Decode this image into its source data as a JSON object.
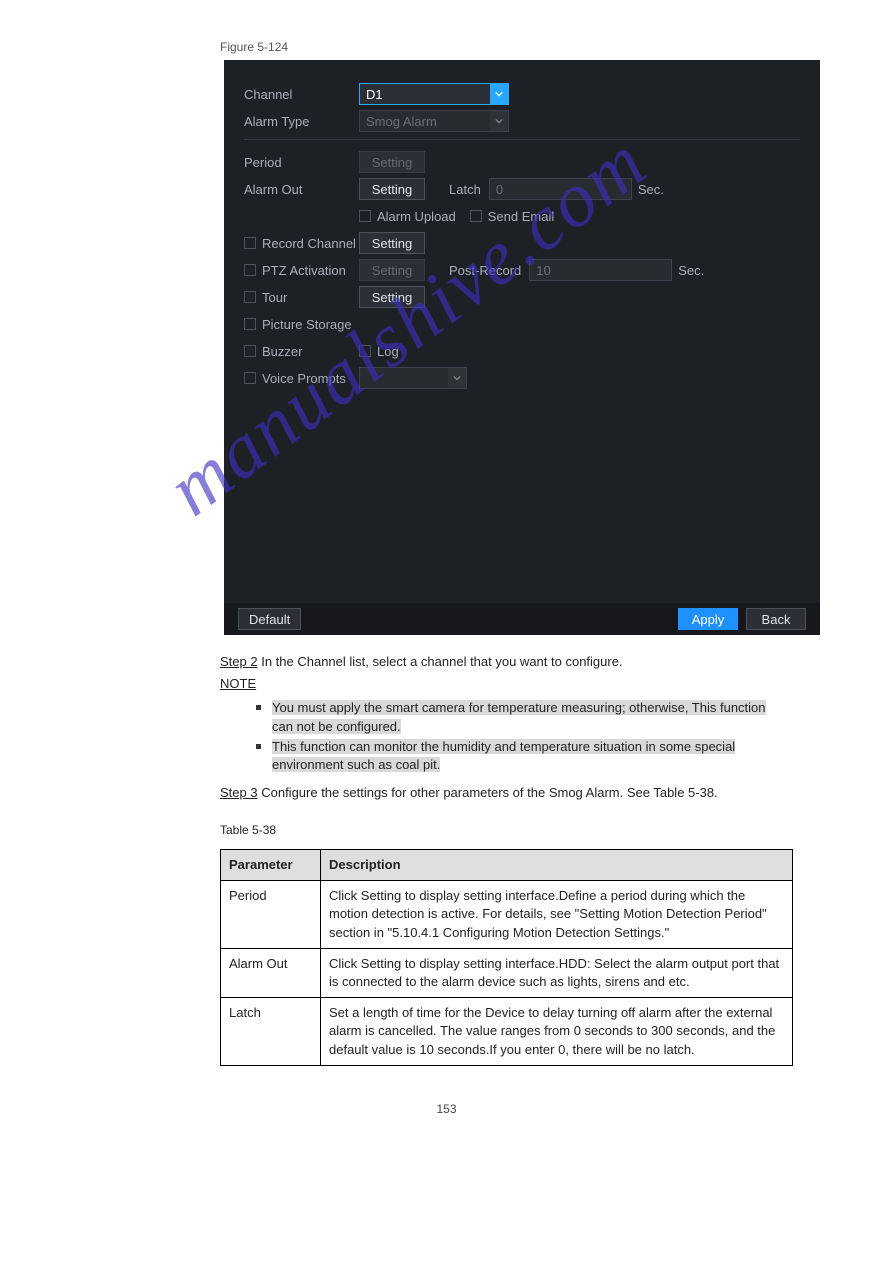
{
  "figure_caption": "Figure 5-124",
  "form": {
    "channel_label": "Channel",
    "channel_value": "D1",
    "alarm_type_label": "Alarm Type",
    "alarm_type_value": "Smog Alarm",
    "period_label": "Period",
    "period_btn": "Setting",
    "alarm_out_label": "Alarm Out",
    "alarm_out_btn": "Setting",
    "latch_label": "Latch",
    "latch_value": "0",
    "sec1": "Sec.",
    "alarm_upload": "Alarm Upload",
    "send_email": "Send Email",
    "record_channel_label": "Record Channel",
    "record_channel_btn": "Setting",
    "ptz_label": "PTZ Activation",
    "ptz_btn": "Setting",
    "post_record_label": "Post-Record",
    "post_record_value": "10",
    "sec2": "Sec.",
    "tour_label": "Tour",
    "tour_btn": "Setting",
    "picture_storage_label": "Picture Storage",
    "buzzer_label": "Buzzer",
    "log_label": "Log",
    "voice_label": "Voice Prompts"
  },
  "buttons": {
    "default": "Default",
    "apply": "Apply",
    "back": "Back"
  },
  "watermark": "manualshive.com",
  "step2_label": "Step 2",
  "step2_text": "In the Channel list, select a channel that you want to configure.",
  "note_label": "NOTE",
  "note1a": "You must apply the smart camera for temperature measuring; otherwise, This function ",
  "note1b": "can not be configured.",
  "note2a": "This function can monitor the humidity and temperature situation in some special ",
  "note2b": "environment such as coal pit.",
  "step3_label": "Step 3",
  "step3_text": "Configure the settings for other parameters of the Smog Alarm. See Table 5-38.",
  "table_caption": "Table 5-38",
  "table": {
    "h1": "Parameter",
    "h2": "Description",
    "r1c1": "Period",
    "r1c2": "Click Setting to display setting interface.Define a period during which the motion detection is active. For details, see \"Setting Motion Detection Period\" section in \"5.10.4.1 Configuring Motion Detection Settings.\"",
    "r2c1": "Alarm Out",
    "r2c2": "Click Setting to display setting interface.HDD: Select the alarm output port that is connected to the alarm device such as lights, sirens and etc.",
    "r3c1": "Latch",
    "r3c2": "Set a length of time for the Device to delay turning off alarm after the external alarm is cancelled. The value ranges from 0 seconds to 300 seconds, and the default value is 10 seconds.If you enter 0, there will be no latch."
  },
  "page_number": "153"
}
